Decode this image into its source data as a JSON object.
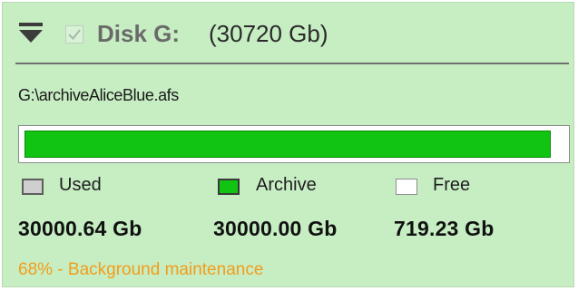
{
  "disk": {
    "name": "Disk G:",
    "size": "(30720 Gb)",
    "checked": true,
    "collapse_icon": "collapse-chevron-icon",
    "checkbox_icon": "checkmark-icon",
    "path": "G:\\archiveAliceBlue.afs"
  },
  "usage": {
    "bar_fill_fraction": 0.977,
    "legend": {
      "used_label": "Used",
      "archive_label": "Archive",
      "free_label": "Free"
    },
    "values": {
      "used": "30000.64 Gb",
      "archive": "30000.00 Gb",
      "free": "719.23 Gb"
    }
  },
  "status": {
    "text": "68% - Background maintenance",
    "color": "#f39c1a"
  },
  "colors": {
    "panel_background": "#c7eec3",
    "archive_green": "#11c411",
    "used_gray": "#cfcfcf",
    "free_white": "#ffffff"
  }
}
